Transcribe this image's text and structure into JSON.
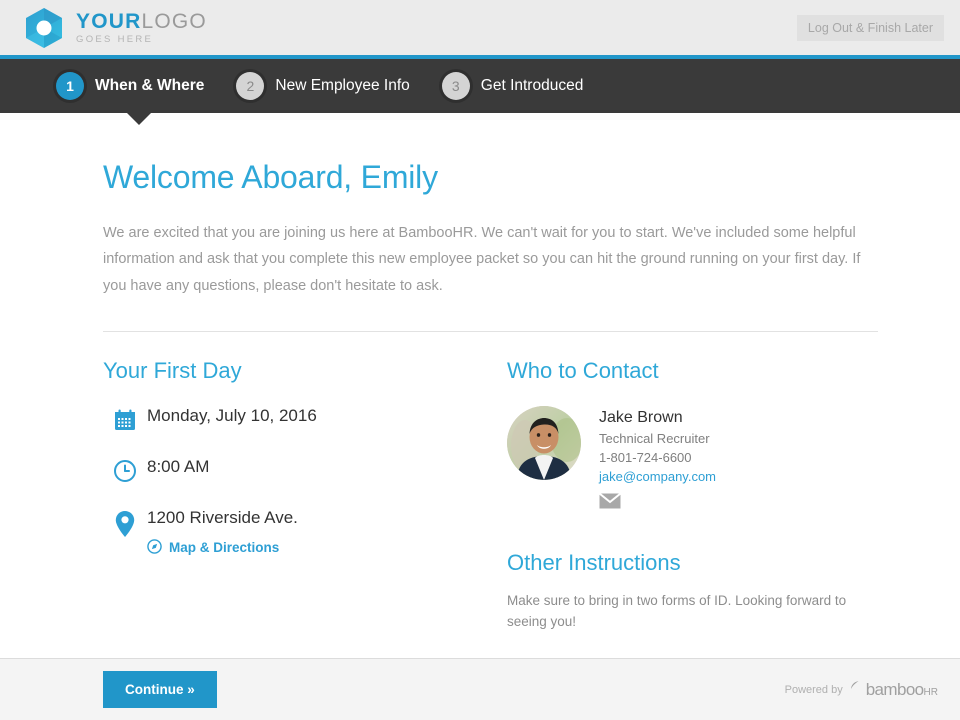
{
  "header": {
    "logo": {
      "icon": "hexagon-logo-icon",
      "title_primary": "YOUR",
      "title_secondary": "LOGO",
      "subtitle": "GOES HERE"
    },
    "logout_label": "Log Out & Finish Later",
    "accent_color": "#2196c9"
  },
  "steps": [
    {
      "number": "1",
      "label": "When & Where",
      "state": "active"
    },
    {
      "number": "2",
      "label": "New Employee Info",
      "state": "inactive"
    },
    {
      "number": "3",
      "label": "Get Introduced",
      "state": "inactive"
    }
  ],
  "main": {
    "title": "Welcome Aboard, Emily",
    "intro": "We are excited that you are joining us here at BambooHR. We can't wait for you to start. We've included some helpful information and ask that you complete this new employee packet so you can hit the ground running on your first day. If you have any questions, please don't hesitate to ask.",
    "first_day": {
      "heading": "Your First Day",
      "date_icon": "calendar-icon",
      "date": "Monday, July 10, 2016",
      "time_icon": "clock-icon",
      "time": "8:00 AM",
      "location_icon": "map-pin-icon",
      "location": "1200 Riverside Ave.",
      "map_link_icon": "compass-icon",
      "map_link_label": "Map & Directions"
    },
    "contact": {
      "heading": "Who to Contact",
      "avatar_icon": "avatar-photo",
      "name": "Jake Brown",
      "role": "Technical Recruiter",
      "phone": "1-801-724-6600",
      "email": "jake@company.com",
      "email_icon": "envelope-icon"
    },
    "instructions": {
      "heading": "Other Instructions",
      "body": "Make sure to bring in two forms of ID. Looking forward to seeing you!"
    }
  },
  "footer": {
    "continue_label": "Continue »",
    "powered_by_label": "Powered by",
    "brand": "bambooHR"
  }
}
